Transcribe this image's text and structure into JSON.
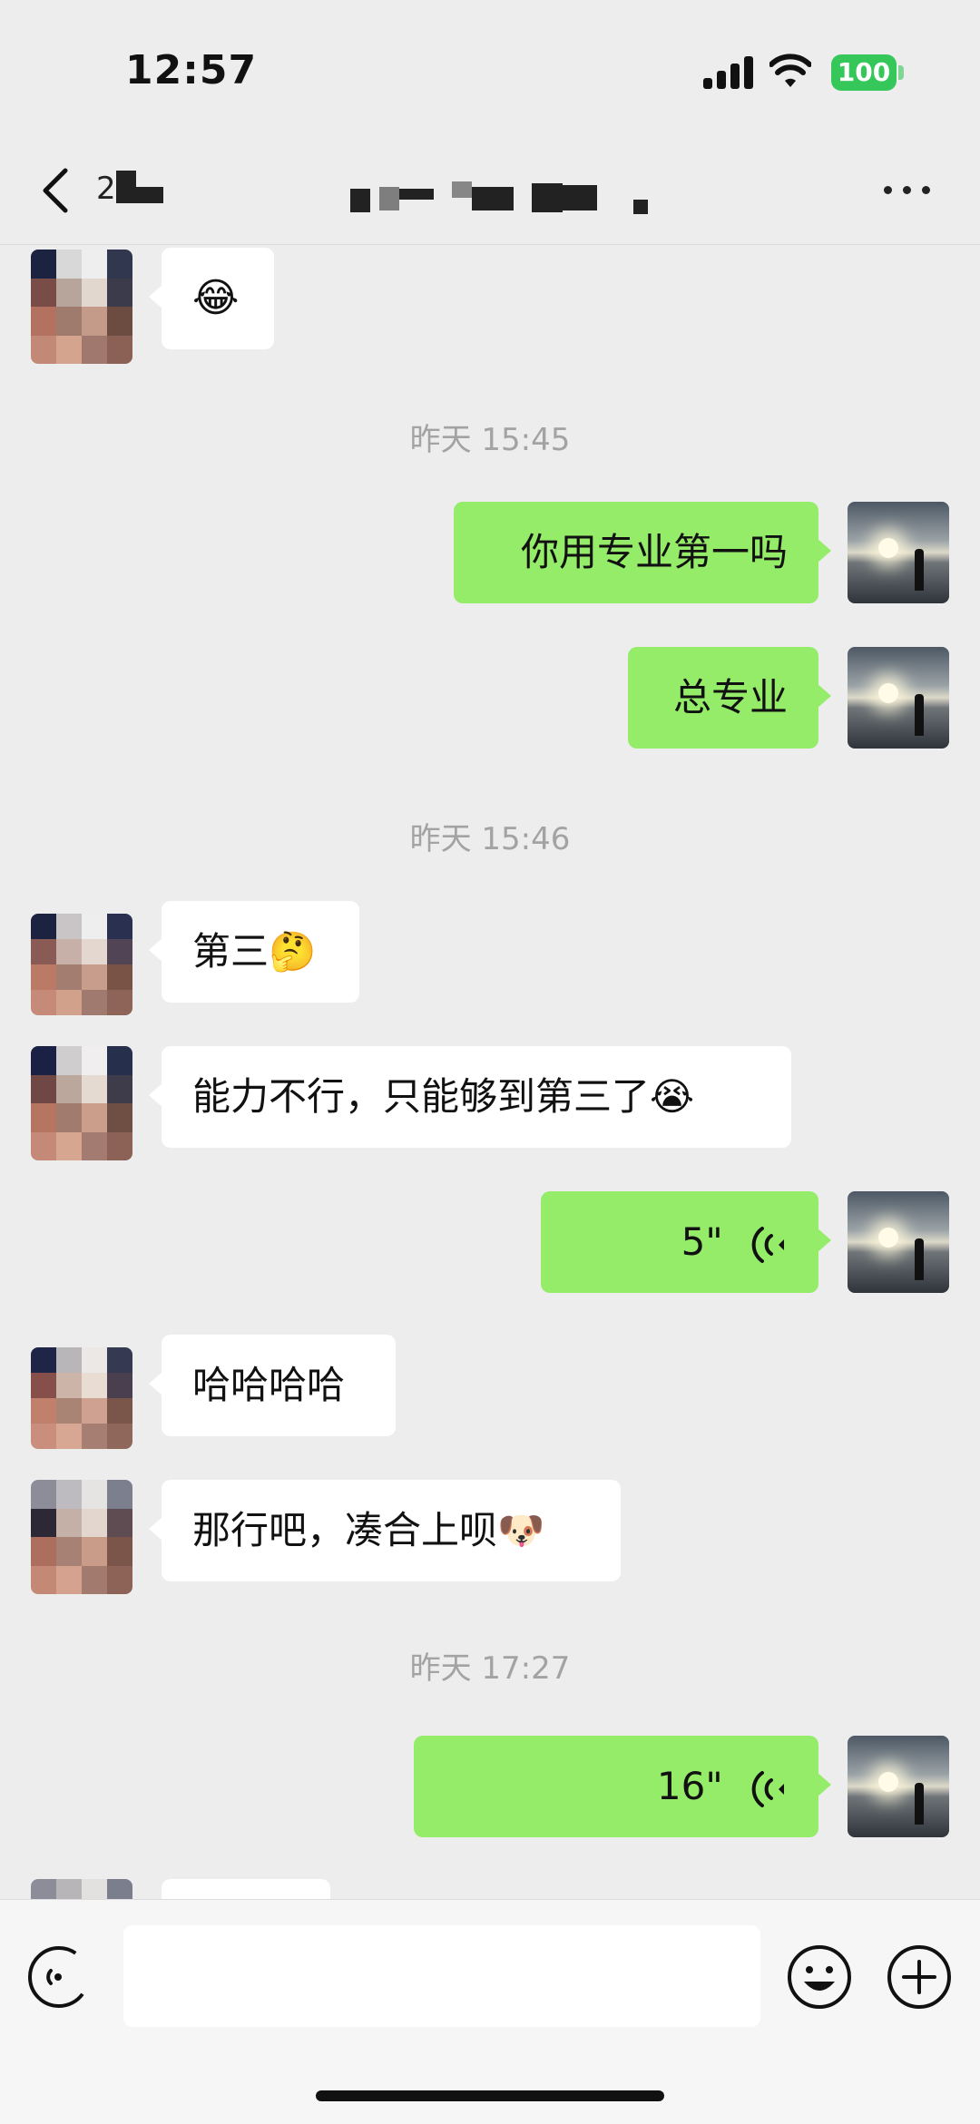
{
  "status_bar": {
    "time": "12:57",
    "battery": "100",
    "battery_color": "#35c759"
  },
  "nav": {
    "back_icon": "chevron-left-icon",
    "count": "2",
    "more_icon": "ellipsis-icon"
  },
  "colors": {
    "background": "#ededed",
    "bubble_self": "#95ec69",
    "bubble_other": "#ffffff",
    "timestamp": "#a3a3a3"
  },
  "messages": [
    {
      "type": "text",
      "side": "other",
      "text": "😂"
    },
    {
      "type": "timestamp",
      "text": "昨天 15:45"
    },
    {
      "type": "text",
      "side": "self",
      "text": "你用专业第一吗"
    },
    {
      "type": "text",
      "side": "self",
      "text": "总专业"
    },
    {
      "type": "timestamp",
      "text": "昨天 15:46"
    },
    {
      "type": "text",
      "side": "other",
      "text": "第三🤔"
    },
    {
      "type": "text",
      "side": "other",
      "text": "能力不行，只能够到第三了😭"
    },
    {
      "type": "voice",
      "side": "self",
      "duration": "5\""
    },
    {
      "type": "text",
      "side": "other",
      "text": "哈哈哈哈"
    },
    {
      "type": "text",
      "side": "other",
      "text": "那行吧，凑合上呗🐶"
    },
    {
      "type": "timestamp",
      "text": "昨天 17:27"
    },
    {
      "type": "voice",
      "side": "self",
      "duration": "16\""
    }
  ],
  "input_bar": {
    "voice_icon": "voice-mode-icon",
    "placeholder": "",
    "emoji_icon": "smile-icon",
    "plus_icon": "plus-circle-icon"
  }
}
